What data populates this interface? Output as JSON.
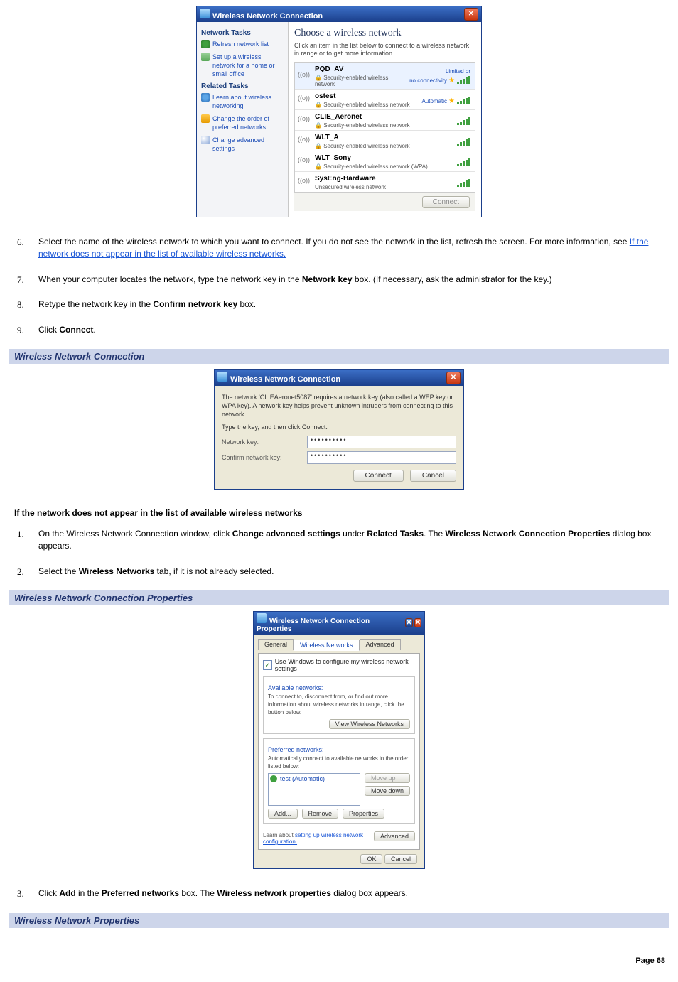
{
  "page_number_label": "Page 68",
  "screenshot1": {
    "title": "Wireless Network Connection",
    "side": {
      "tasks_hdr": "Network Tasks",
      "refresh": "Refresh network list",
      "setup": "Set up a wireless network for a home or small office",
      "related_hdr": "Related Tasks",
      "learn": "Learn about wireless networking",
      "order": "Change the order of preferred networks",
      "adv": "Change advanced settings"
    },
    "main_heading": "Choose a wireless network",
    "main_sub": "Click an item in the list below to connect to a wireless network in range or to get more information.",
    "networks": [
      {
        "name": "PQD_AV",
        "desc": "Security-enabled wireless network",
        "right": "Limited or no connectivity",
        "star": true
      },
      {
        "name": "ostest",
        "desc": "Security-enabled wireless network",
        "right": "Automatic",
        "star": true
      },
      {
        "name": "CLIE_Aeronet",
        "desc": "Security-enabled wireless network",
        "right": ""
      },
      {
        "name": "WLT_A",
        "desc": "Security-enabled wireless network",
        "right": ""
      },
      {
        "name": "WLT_Sony",
        "desc": "Security-enabled wireless network (WPA)",
        "right": ""
      },
      {
        "name": "SysEng-Hardware",
        "desc": "Unsecured wireless network",
        "right": "",
        "unsec": true
      }
    ],
    "connect_btn": "Connect"
  },
  "steps_a": {
    "s6_a": "Select the name of the wireless network to which you want to connect. If you do not see the network in the list, refresh the screen. For more information, see ",
    "s6_link": "If the network does not appear in the list of available wireless networks.",
    "s7_a": "When your computer locates the network, type the network key in the ",
    "s7_b": "Network key",
    "s7_c": " box. (If necessary, ask the administrator for the key.)",
    "s8_a": "Retype the network key in the ",
    "s8_b": "Confirm network key",
    "s8_c": " box.",
    "s9_a": "Click ",
    "s9_b": "Connect",
    "s9_c": "."
  },
  "caption1": "Wireless Network Connection",
  "screenshot2": {
    "title": "Wireless Network Connection",
    "msg": "The network 'CLIEAeronet5087' requires a network key (also called a WEP key or WPA key). A network key helps prevent unknown intruders from connecting to this network.",
    "hint": "Type the key, and then click Connect.",
    "lbl_key": "Network key:",
    "lbl_confirm": "Confirm network key:",
    "mask": "••••••••••",
    "btn_connect": "Connect",
    "btn_cancel": "Cancel"
  },
  "subheading_nolist": "If the network does not appear in the list of available wireless networks",
  "steps_b": {
    "s1_a": "On the Wireless Network Connection window, click ",
    "s1_b": "Change advanced settings",
    "s1_c": " under ",
    "s1_d": "Related Tasks",
    "s1_e": ". The ",
    "s1_f": "Wireless Network Connection Properties",
    "s1_g": " dialog box appears.",
    "s2_a": "Select the ",
    "s2_b": "Wireless Networks",
    "s2_c": " tab, if it is not already selected."
  },
  "caption2": "Wireless Network Connection Properties",
  "screenshot3": {
    "title": "Wireless Network Connection Properties",
    "tab_general": "General",
    "tab_wireless": "Wireless Networks",
    "tab_adv": "Advanced",
    "chk_label": "Use Windows to configure my wireless network settings",
    "avail_hdr": "Available networks:",
    "avail_hint": "To connect to, disconnect from, or find out more information about wireless networks in range, click the button below.",
    "btn_view": "View Wireless Networks",
    "pref_hdr": "Preferred networks:",
    "pref_hint": "Automatically connect to available networks in the order listed below:",
    "pref_item": "test (Automatic)",
    "btn_moveup": "Move up",
    "btn_movedown": "Move down",
    "btn_add": "Add...",
    "btn_remove": "Remove",
    "btn_prop": "Properties",
    "learn_a": "Learn about ",
    "learn_b": "setting up wireless network configuration.",
    "btn_advanced": "Advanced",
    "btn_ok": "OK",
    "btn_cancel": "Cancel"
  },
  "steps_c": {
    "s3_a": "Click ",
    "s3_b": "Add",
    "s3_c": " in the ",
    "s3_d": "Preferred networks",
    "s3_e": " box. The ",
    "s3_f": "Wireless network properties",
    "s3_g": " dialog box appears."
  },
  "caption3": "Wireless Network Properties"
}
